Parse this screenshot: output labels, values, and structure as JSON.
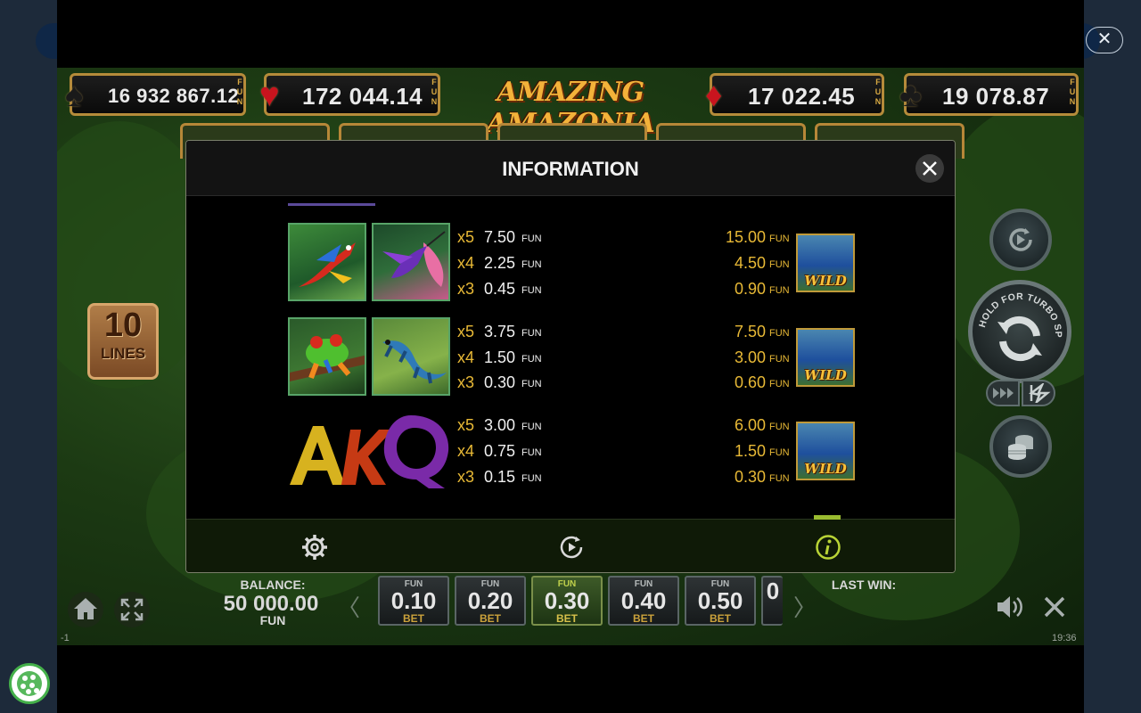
{
  "jackpots": [
    {
      "suit": "spade",
      "value": "16 932 867.12",
      "unit": "FUN"
    },
    {
      "suit": "heart",
      "value": "172 044.14",
      "unit": "FUN"
    },
    {
      "suit": "diamond",
      "value": "17 022.45",
      "unit": "FUN"
    },
    {
      "suit": "club",
      "value": "19 078.87",
      "unit": "FUN"
    }
  ],
  "game_title": "AMAZING AMAZONIA",
  "lines": {
    "count": "10",
    "label": "LINES"
  },
  "hold_text": "HOLD FOR TURBO SPIN",
  "balance": {
    "label": "BALANCE:",
    "value": "50 000.00",
    "unit": "FUN"
  },
  "bets": [
    {
      "unit": "FUN",
      "value": "0.10",
      "label": "BET"
    },
    {
      "unit": "FUN",
      "value": "0.20",
      "label": "BET"
    },
    {
      "unit": "FUN",
      "value": "0.30",
      "label": "BET",
      "selected": true
    },
    {
      "unit": "FUN",
      "value": "0.40",
      "label": "BET"
    },
    {
      "unit": "FUN",
      "value": "0.50",
      "label": "BET"
    },
    {
      "unit": "",
      "value": "0",
      "label": ""
    }
  ],
  "last_win_label": "LAST WIN:",
  "status": {
    "left": "-1",
    "time": "19:36"
  },
  "modal": {
    "title": "INFORMATION",
    "rows": [
      {
        "symbols": [
          "scarlet-macaw",
          "hummingbird"
        ],
        "pays": [
          {
            "mult": "x5",
            "amount": "7.50",
            "unit": "FUN",
            "wild_amount": "15.00"
          },
          {
            "mult": "x4",
            "amount": "2.25",
            "unit": "FUN",
            "wild_amount": "4.50"
          },
          {
            "mult": "x3",
            "amount": "0.45",
            "unit": "FUN",
            "wild_amount": "0.90"
          }
        ],
        "wild_label": "WILD"
      },
      {
        "symbols": [
          "tree-frog",
          "lizard"
        ],
        "pays": [
          {
            "mult": "x5",
            "amount": "3.75",
            "unit": "FUN",
            "wild_amount": "7.50"
          },
          {
            "mult": "x4",
            "amount": "1.50",
            "unit": "FUN",
            "wild_amount": "3.00"
          },
          {
            "mult": "x3",
            "amount": "0.30",
            "unit": "FUN",
            "wild_amount": "0.60"
          }
        ],
        "wild_label": "WILD"
      },
      {
        "symbols": [
          "letters-akq"
        ],
        "letters": "AKQ",
        "pays": [
          {
            "mult": "x5",
            "amount": "3.00",
            "unit": "FUN",
            "wild_amount": "6.00"
          },
          {
            "mult": "x4",
            "amount": "0.75",
            "unit": "FUN",
            "wild_amount": "1.50"
          },
          {
            "mult": "x3",
            "amount": "0.15",
            "unit": "FUN",
            "wild_amount": "0.30"
          }
        ],
        "wild_label": "WILD"
      }
    ],
    "footer_tabs": [
      "settings",
      "autoplay",
      "information"
    ]
  },
  "colors": {
    "accent_gold": "#e8b936",
    "modal_bg": "#000000",
    "selected_tab": "#9abb30"
  }
}
